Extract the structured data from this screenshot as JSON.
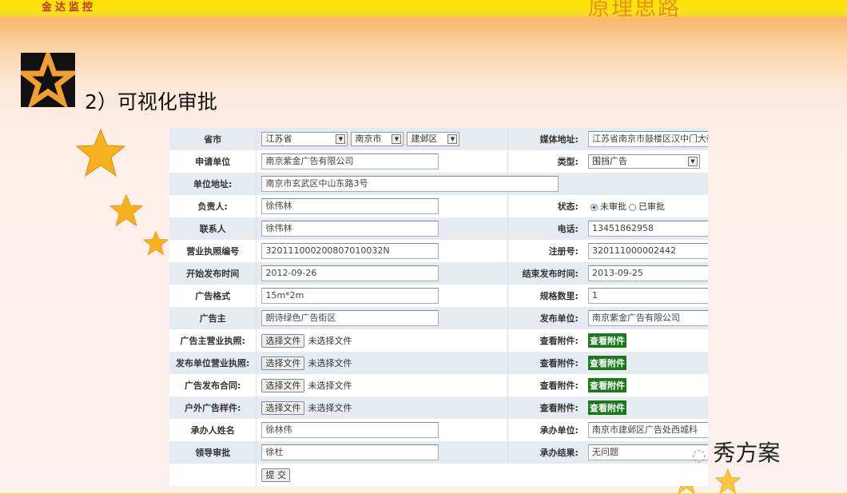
{
  "header": {
    "brand": "金达监控",
    "slide_title": "原理思路"
  },
  "heading": "2）可视化审批",
  "form": {
    "province_label": "省市",
    "province": "江苏省",
    "city": "南京市",
    "district": "建邺区",
    "media_address_label": "媒体地址:",
    "media_address": "江苏省南京市鼓楼区汉中门大街",
    "applicant_label": "申请单位",
    "applicant": "南京紫金广告有限公司",
    "type_label": "类型:",
    "type": "围挡广告",
    "address_label": "单位地址:",
    "address": "南京市玄武区中山东路3号",
    "manager_label": "负责人:",
    "manager": "徐伟林",
    "status_label": "状态:",
    "status_options": [
      "未审批",
      "已审批"
    ],
    "status_selected": "未审批",
    "contact_label": "联系人",
    "contact": "徐伟林",
    "phone_label": "电话:",
    "phone": "13451862958",
    "license_no_label": "营业执照编号",
    "license_no": "320111000200807010032N",
    "reg_no_label": "注册号:",
    "reg_no": "320111000002442",
    "start_label": "开始发布时间",
    "start": "2012-09-26",
    "end_label": "结束发布时间:",
    "end": "2013-09-25",
    "format_label": "广告格式",
    "format": "15m*2m",
    "quantity_label": "规格数里:",
    "quantity": "1",
    "advertiser_label": "广告主",
    "advertiser": "朗诗绿色广告街区",
    "publisher_label": "发布单位:",
    "publisher": "南京紫金广告有限公司",
    "file_rows": [
      {
        "label": "广告主营业执照:"
      },
      {
        "label": "发布单位营业执照:"
      },
      {
        "label": "广告发布合同:"
      },
      {
        "label": "户外广告样件:"
      }
    ],
    "choose_file": "选择文件",
    "no_file": "未选择文件",
    "view_attach_label": "查看附件:",
    "view_attach_button": "查看附件",
    "handler_label": "承办人姓名",
    "handler": "徐林伟",
    "handling_unit_label": "承办单位:",
    "handling_unit": "南京市建邺区广告处西城科",
    "leader_label": "领导审批",
    "leader": "徐杜",
    "result_label": "承办结果:",
    "result": "无问题",
    "submit": "提 交"
  },
  "watermark": "秀方案",
  "colors": {
    "header_yellow": "#fde000",
    "attach_green": "#187a18"
  }
}
